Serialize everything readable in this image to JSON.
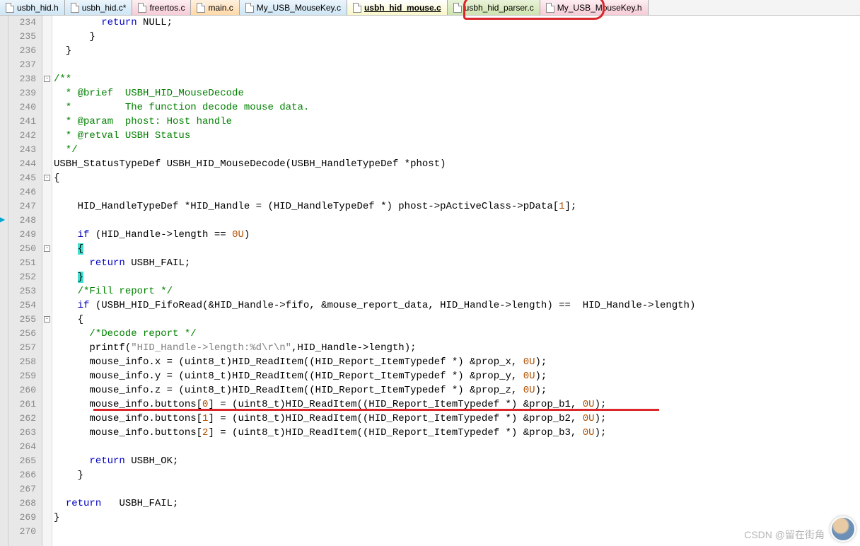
{
  "tabs": [
    {
      "label": "usbh_hid.h",
      "cls": "tab-blue"
    },
    {
      "label": "usbh_hid.c*",
      "cls": "tab-blue"
    },
    {
      "label": "freertos.c",
      "cls": "tab-pink"
    },
    {
      "label": "main.c",
      "cls": "tab-orange"
    },
    {
      "label": "My_USB_MouseKey.c",
      "cls": "tab-blue"
    },
    {
      "label": "usbh_hid_mouse.c",
      "cls": "tab-active"
    },
    {
      "label": "usbh_hid_parser.c",
      "cls": "tab-green"
    },
    {
      "label": "My_USB_MouseKey.h",
      "cls": "tab-pink"
    }
  ],
  "startLine": 234,
  "fold": {
    "238": "⊟",
    "245": "⊟",
    "250": "⊟",
    "255": "⊟"
  },
  "code": [
    {
      "t": "        <span class='kw'>return</span> NULL;"
    },
    {
      "t": "      }"
    },
    {
      "t": "  }"
    },
    {
      "t": ""
    },
    {
      "t": "<span class='cm'>/**</span>"
    },
    {
      "t": "<span class='cm'>  * @brief  USBH_HID_MouseDecode</span>"
    },
    {
      "t": "<span class='cm'>  *         The function decode mouse data.</span>"
    },
    {
      "t": "<span class='cm'>  * @param  phost: Host handle</span>"
    },
    {
      "t": "<span class='cm'>  * @retval USBH Status</span>"
    },
    {
      "t": "<span class='cm'>  */</span>"
    },
    {
      "t": "USBH_StatusTypeDef USBH_HID_MouseDecode(USBH_HandleTypeDef *phost)"
    },
    {
      "t": "{"
    },
    {
      "t": ""
    },
    {
      "t": "    HID_HandleTypeDef *HID_Handle = (HID_HandleTypeDef *) phost-&gt;pActiveClass-&gt;pData[<span class='num'>1</span>];"
    },
    {
      "t": ""
    },
    {
      "t": "    <span class='kw'>if</span> (HID_Handle-&gt;length == <span class='num'>0U</span>)"
    },
    {
      "t": "    <span class='hlbrace'>{</span>"
    },
    {
      "t": "      <span class='kw'>return</span> USBH_FAIL;"
    },
    {
      "t": "    <span class='hlbrace'>}</span>"
    },
    {
      "t": "    <span class='cm'>/*Fill report */</span>"
    },
    {
      "t": "    <span class='kw'>if</span> (USBH_HID_FifoRead(&amp;HID_Handle-&gt;fifo, &amp;mouse_report_data, HID_Handle-&gt;length) ==  HID_Handle-&gt;length)"
    },
    {
      "t": "    {"
    },
    {
      "t": "      <span class='cm'>/*Decode report */</span>"
    },
    {
      "t": "      printf(<span class='str'>\"HID_Handle-&gt;length:%d\\r\\n\"</span>,HID_Handle-&gt;length);"
    },
    {
      "t": "      mouse_info.x = (uint8_t)HID_ReadItem((HID_Report_ItemTypedef *) &amp;prop_x, <span class='num'>0U</span>);"
    },
    {
      "t": "      mouse_info.y = (uint8_t)HID_ReadItem((HID_Report_ItemTypedef *) &amp;prop_y, <span class='num'>0U</span>);"
    },
    {
      "t": "      mouse_info.z = (uint8_t)HID_ReadItem((HID_Report_ItemTypedef *) &amp;prop_z, <span class='num'>0U</span>);"
    },
    {
      "t": "      mouse_info.buttons[<span class='num'>0</span>] = (uint8_t)HID_ReadItem((HID_Report_ItemTypedef *) &amp;prop_b1, <span class='num'>0U</span>);"
    },
    {
      "t": "      mouse_info.buttons[<span class='num'>1</span>] = (uint8_t)HID_ReadItem((HID_Report_ItemTypedef *) &amp;prop_b2, <span class='num'>0U</span>);"
    },
    {
      "t": "      mouse_info.buttons[<span class='num'>2</span>] = (uint8_t)HID_ReadItem((HID_Report_ItemTypedef *) &amp;prop_b3, <span class='num'>0U</span>);"
    },
    {
      "t": ""
    },
    {
      "t": "      <span class='kw'>return</span> USBH_OK;"
    },
    {
      "t": "    }"
    },
    {
      "t": ""
    },
    {
      "t": "  <span class='kw'>return</span>   USBH_FAIL;"
    },
    {
      "t": "}"
    },
    {
      "t": ""
    }
  ],
  "watermark": "CSDN @留在街角"
}
